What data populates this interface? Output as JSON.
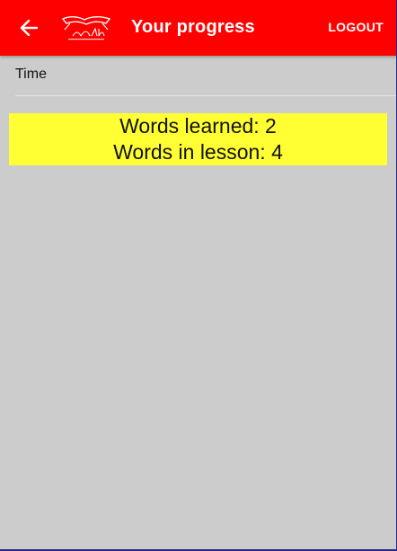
{
  "header": {
    "title": "Your progress",
    "logout_label": "LOGOUT",
    "back_icon": "arrow-left-icon",
    "logo_icon": "akn-logo"
  },
  "main": {
    "time_label": "Time",
    "words_learned": "Words learned: 2",
    "words_in_lesson": "Words in lesson: 4"
  },
  "colors": {
    "appbar": "#ff0000",
    "background": "#cccccc",
    "highlight": "#ffff33"
  }
}
